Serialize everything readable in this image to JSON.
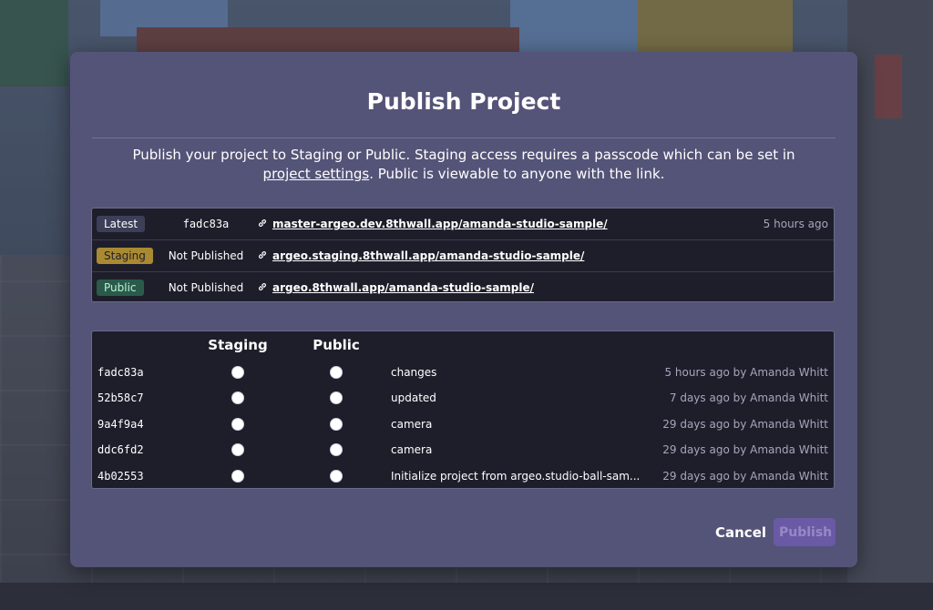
{
  "modal": {
    "title": "Publish Project",
    "description_before": "Publish your project to Staging or Public. Staging access requires a passcode which can be set in ",
    "description_link": "project settings",
    "description_after": ". Public is viewable to anyone with the link."
  },
  "deployments": [
    {
      "env": "Latest",
      "commit": "fadc83a",
      "url": "master-argeo.dev.8thwall.app/amanda-studio-sample/",
      "time": "5 hours ago"
    },
    {
      "env": "Staging",
      "commit": "Not Published",
      "url": "argeo.staging.8thwall.app/amanda-studio-sample/",
      "time": ""
    },
    {
      "env": "Public",
      "commit": "Not Published",
      "url": "argeo.8thwall.app/amanda-studio-sample/",
      "time": ""
    }
  ],
  "commits_table": {
    "col_staging": "Staging",
    "col_public": "Public",
    "rows": [
      {
        "hash": "fadc83a",
        "message": "changes",
        "meta": "5 hours ago by Amanda Whitt"
      },
      {
        "hash": "52b58c7",
        "message": "updated",
        "meta": "7 days ago by Amanda Whitt"
      },
      {
        "hash": "9a4f9a4",
        "message": "camera",
        "meta": "29 days ago by Amanda Whitt"
      },
      {
        "hash": "ddc6fd2",
        "message": "camera",
        "meta": "29 days ago by Amanda Whitt"
      },
      {
        "hash": "4b02553",
        "message": "Initialize project from argeo.studio-ball-sam...",
        "meta": "29 days ago by Amanda Whitt"
      }
    ]
  },
  "footer": {
    "cancel_label": "Cancel",
    "publish_label": "Publish",
    "publish_disabled": true
  },
  "colors": {
    "modal_bg": "#545478",
    "table_bg": "#1e1e2b",
    "staging_badge": "#a98a32",
    "public_badge": "#2b5a4a",
    "publish_button": "#6a5aa6"
  },
  "icons": {
    "deployment_link": "link-icon"
  }
}
